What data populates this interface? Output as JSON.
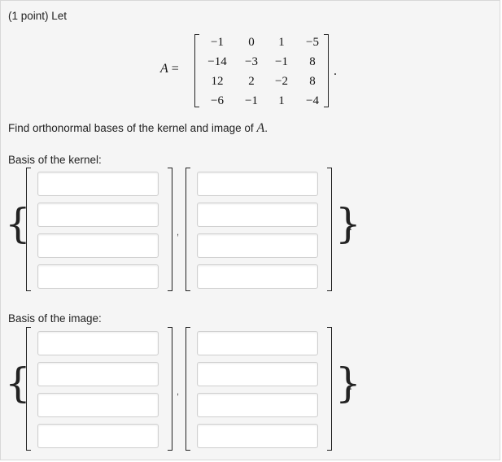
{
  "problem": {
    "header": "(1 point) Let",
    "matrix_name": "A",
    "equals": "=",
    "matrix": [
      [
        "−1",
        "0",
        "1",
        "−5"
      ],
      [
        "−14",
        "−3",
        "−1",
        "8"
      ],
      [
        "12",
        "2",
        "−2",
        "8"
      ],
      [
        "−6",
        "−1",
        "1",
        "−4"
      ]
    ],
    "matrix_period": ".",
    "question": "Find orthonormal bases of the kernel and image of",
    "question_symbol": "A",
    "question_end": "."
  },
  "kernel": {
    "label": "Basis of the kernel:",
    "vectors": [
      [
        "",
        "",
        "",
        ""
      ],
      [
        "",
        "",
        "",
        ""
      ]
    ]
  },
  "image": {
    "label": "Basis of the image:",
    "vectors": [
      [
        "",
        "",
        "",
        ""
      ],
      [
        "",
        "",
        "",
        ""
      ]
    ]
  },
  "set_symbols": {
    "open_brace": "{",
    "close_brace": "}",
    "separator": ",",
    "period": "."
  }
}
